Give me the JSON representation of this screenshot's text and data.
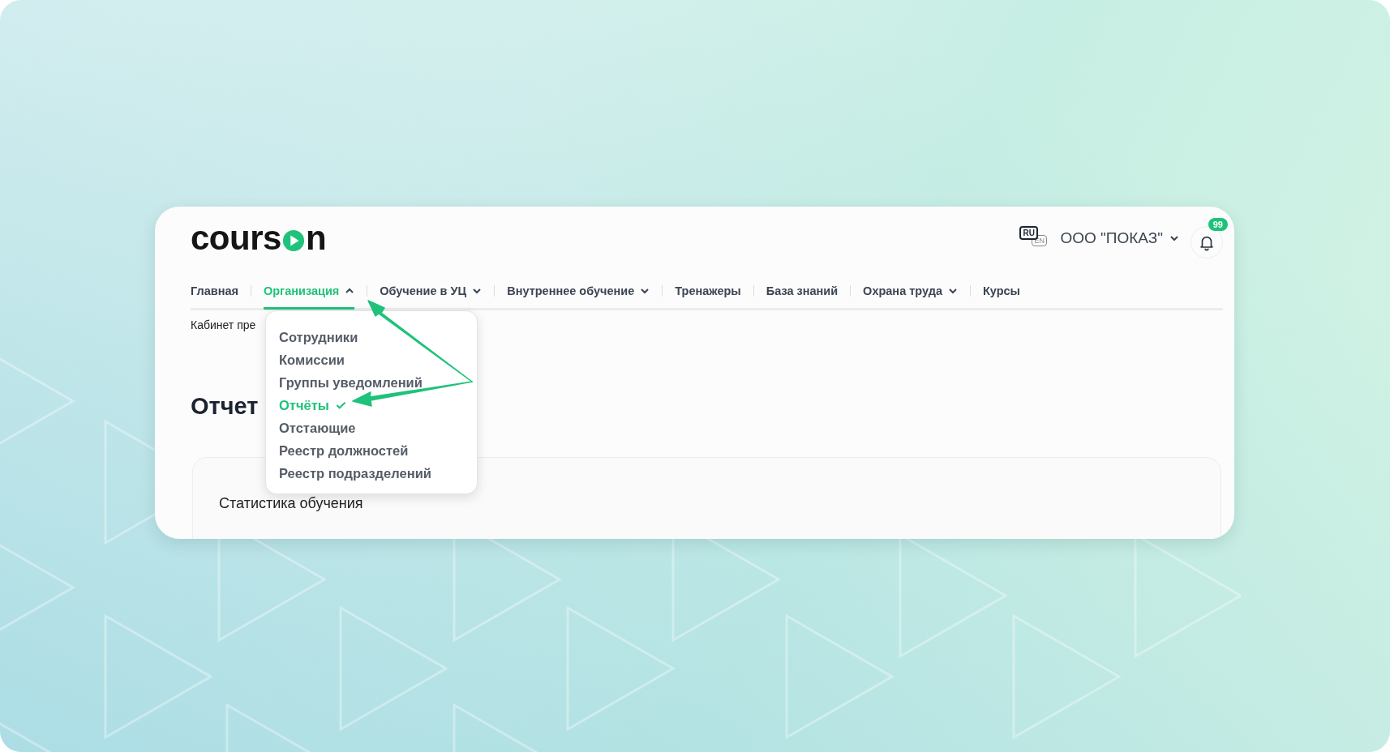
{
  "logo": {
    "text_start": "cours",
    "text_end": "n"
  },
  "header": {
    "languages": [
      {
        "label": "RU",
        "selected": true
      },
      {
        "label": "EN",
        "selected": false
      }
    ],
    "organization": "ООО \"ПОКАЗ\"",
    "notifications_badge": "99"
  },
  "nav": [
    {
      "kind": "link",
      "label": "Главная",
      "selected": false
    },
    {
      "kind": "dropdown",
      "label": "Организация",
      "selected": true,
      "expanded": true
    },
    {
      "kind": "dropdown",
      "label": "Обучение в УЦ",
      "selected": false,
      "expanded": false
    },
    {
      "kind": "dropdown",
      "label": "Внутреннее обучение",
      "selected": false,
      "expanded": false
    },
    {
      "kind": "link",
      "label": "Тренажеры",
      "selected": false
    },
    {
      "kind": "link",
      "label": "База знаний",
      "selected": false
    },
    {
      "kind": "dropdown",
      "label": "Охрана труда",
      "selected": false,
      "expanded": false
    },
    {
      "kind": "link",
      "label": "Курсы",
      "selected": false
    }
  ],
  "dropdown": [
    {
      "label": "Сотрудники",
      "selected": false
    },
    {
      "label": "Комиссии",
      "selected": false
    },
    {
      "label": "Группы уведомлений",
      "selected": false
    },
    {
      "label": "Отчёты",
      "selected": true
    },
    {
      "label": "Отстающие",
      "selected": false
    },
    {
      "label": "Реестр должностей",
      "selected": false
    },
    {
      "label": "Реестр подразделений",
      "selected": false
    }
  ],
  "breadcrumb": "Кабинет пре",
  "page_title": "Отчет",
  "stats_card": {
    "title": "Статистика обучения"
  }
}
